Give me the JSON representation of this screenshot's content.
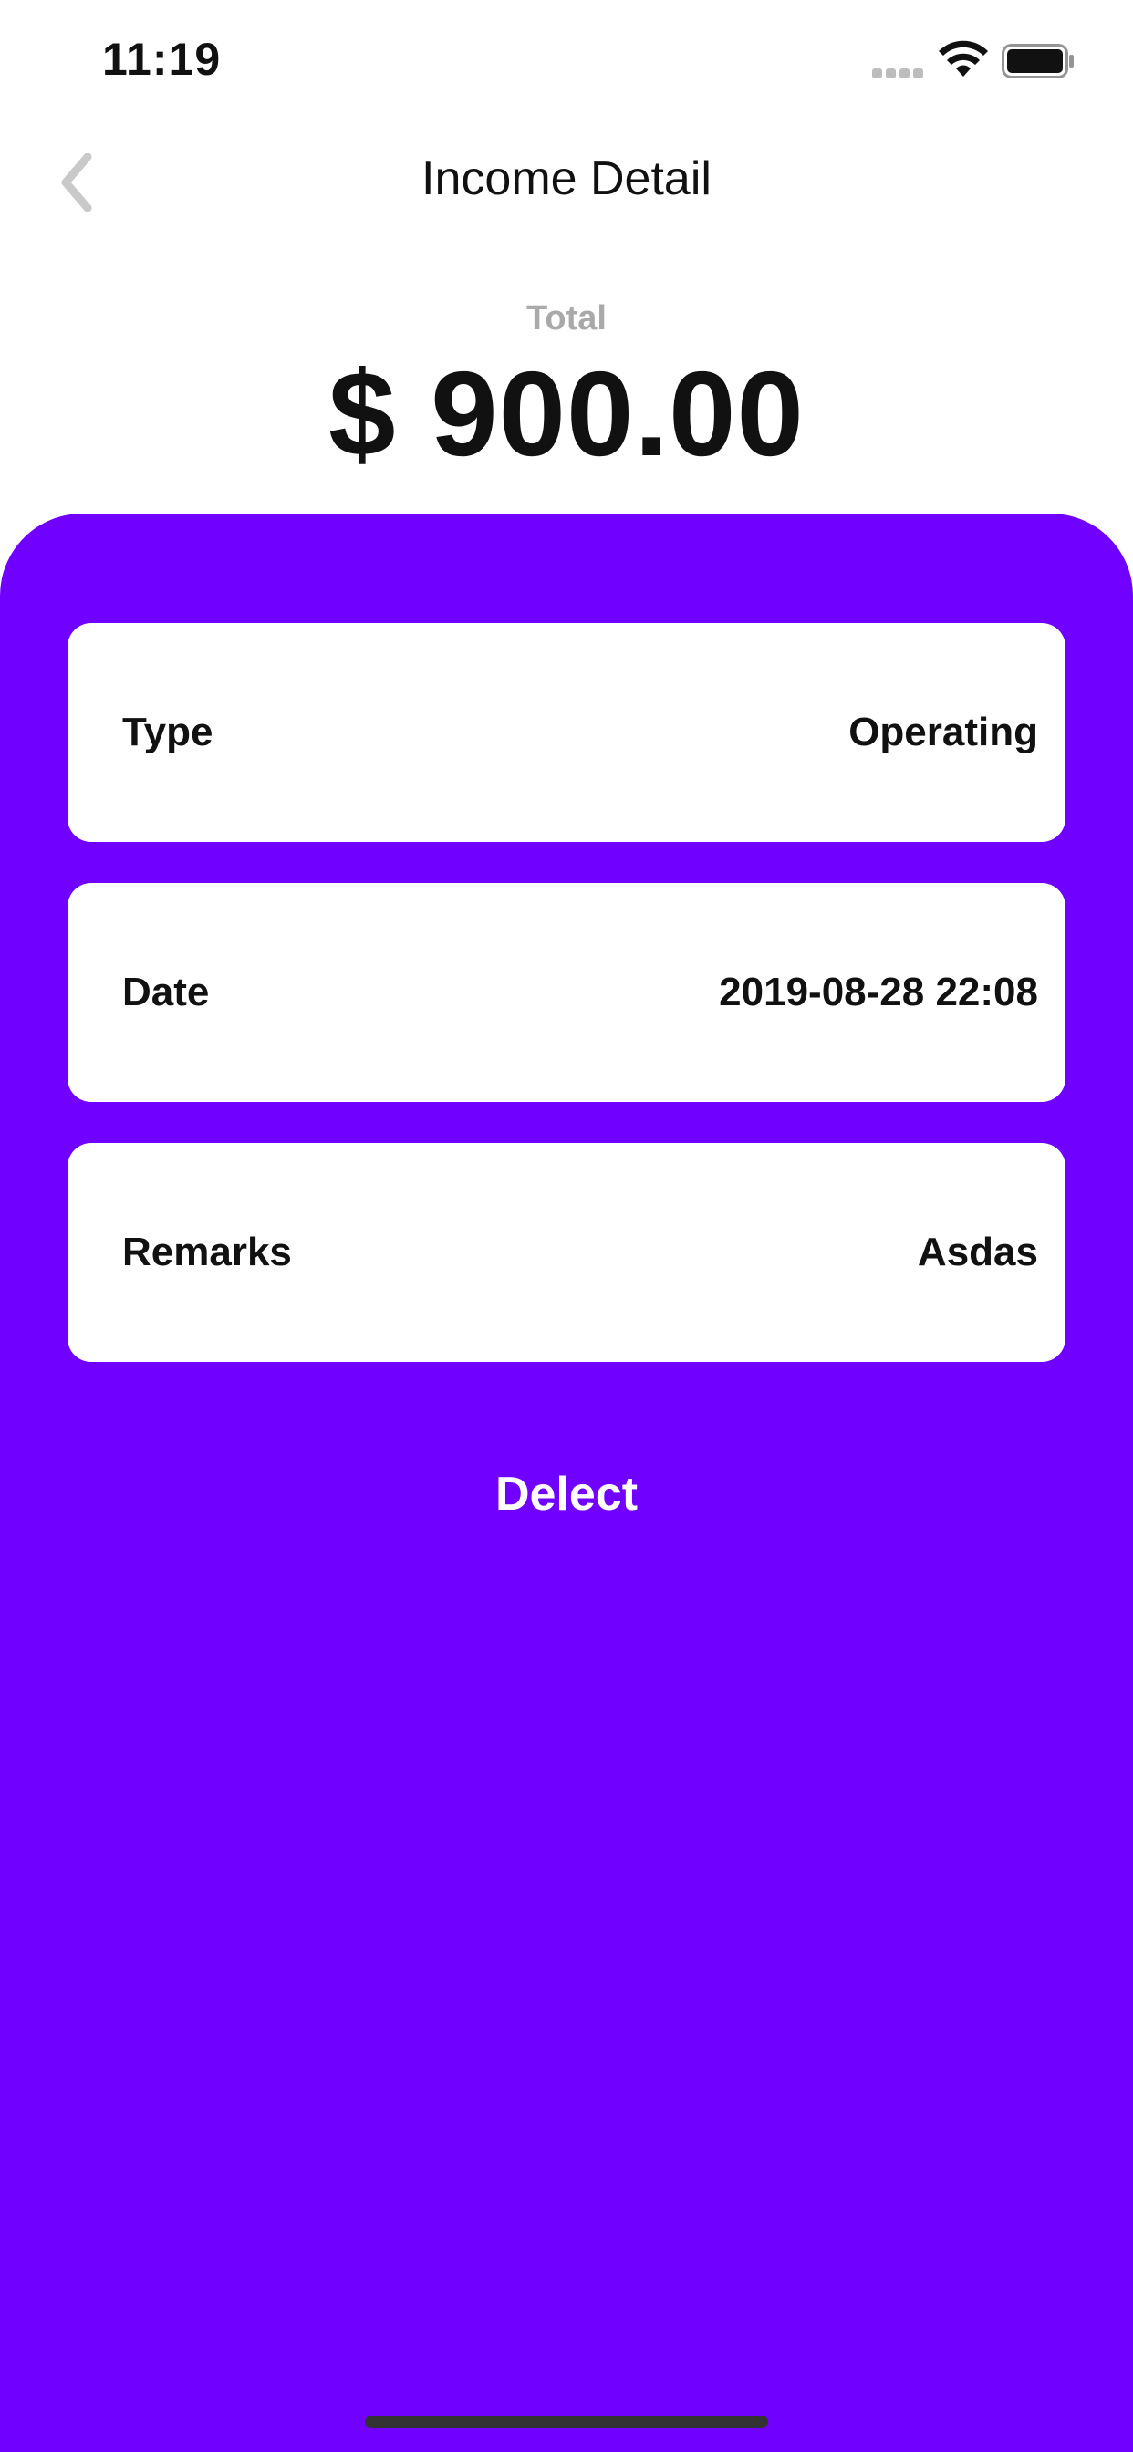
{
  "status_bar": {
    "time": "11:19",
    "icons": [
      "signal-icon",
      "wifi-icon",
      "battery-icon"
    ]
  },
  "nav": {
    "back_icon": "chevron-left-icon",
    "title": "Income Detail"
  },
  "summary": {
    "label": "Total",
    "amount": "$ 900.00"
  },
  "details": [
    {
      "label": "Type",
      "value": "Operating"
    },
    {
      "label": "Date",
      "value": "2019-08-28 22:08"
    },
    {
      "label": "Remarks",
      "value": "Asdas"
    }
  ],
  "actions": {
    "delete_label": "Delect"
  },
  "colors": {
    "accent": "#7000ff",
    "card": "#ffffff",
    "text": "#111111",
    "muted": "#a9a9a9"
  }
}
